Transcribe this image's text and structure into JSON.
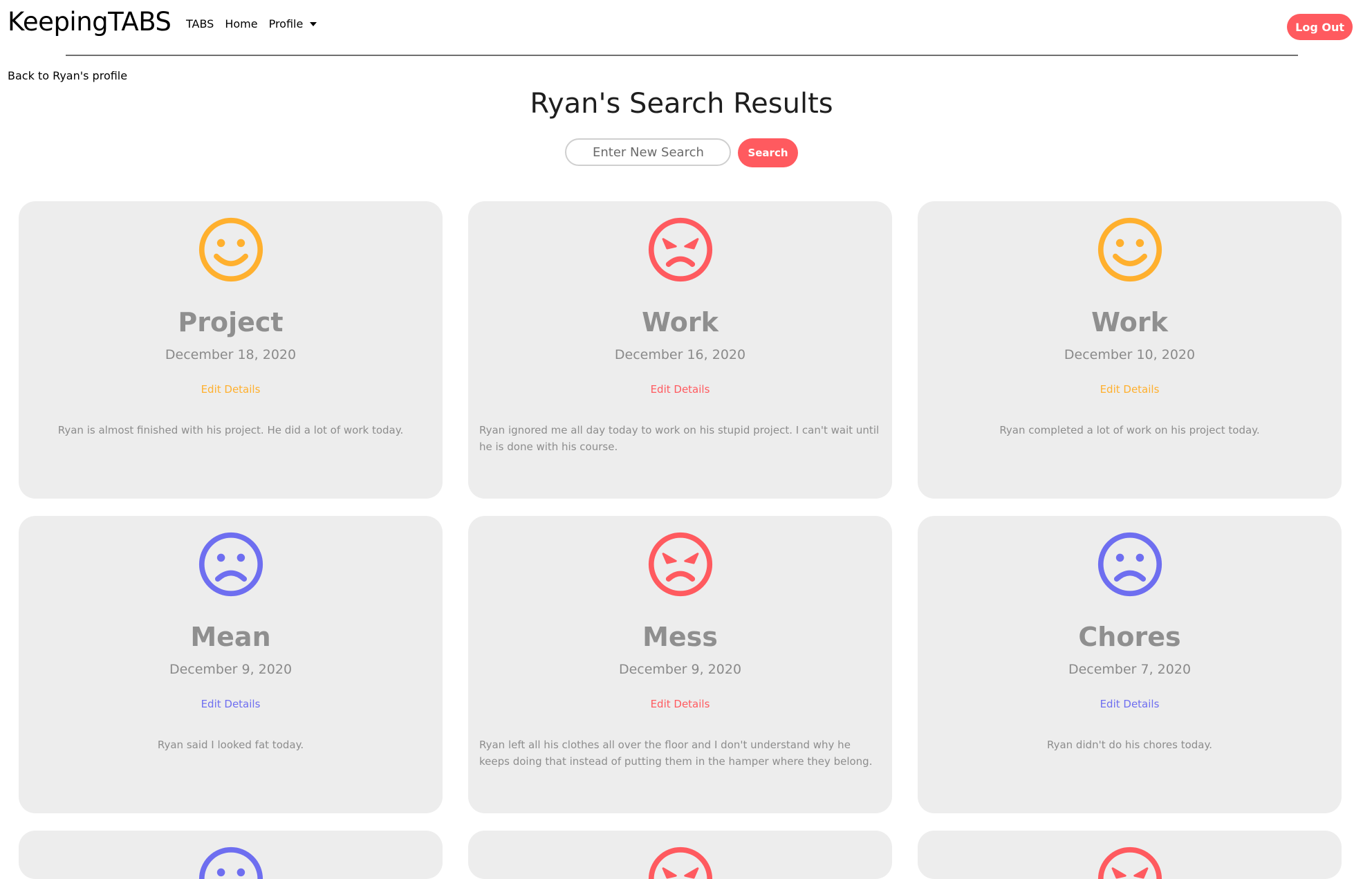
{
  "navbar": {
    "brand": "KeepingTABS",
    "links": [
      "TABS",
      "Home",
      "Profile"
    ],
    "logout_label": "Log Out"
  },
  "back_link": "Back to Ryan's profile",
  "page_title": "Ryan's Search Results",
  "search": {
    "placeholder": "Enter New Search",
    "button_label": "Search"
  },
  "colors": {
    "brand": "#ff5a5f",
    "happy": "#ffb02e",
    "angry": "#ff5a5f",
    "sad": "#6e6ef0"
  },
  "cards": [
    {
      "mood": "happy",
      "icon": "smiley-face-icon",
      "title": "Project",
      "date": "December 18, 2020",
      "edit_label": "Edit Details",
      "body": "Ryan is almost finished with his project. He did a lot of work today."
    },
    {
      "mood": "angry",
      "icon": "angry-face-icon",
      "title": "Work",
      "date": "December 16, 2020",
      "edit_label": "Edit Details",
      "body": "Ryan ignored me all day today to work on his stupid project. I can't wait until he is done with his course."
    },
    {
      "mood": "happy",
      "icon": "smiley-face-icon",
      "title": "Work",
      "date": "December 10, 2020",
      "edit_label": "Edit Details",
      "body": "Ryan completed a lot of work on his project today."
    },
    {
      "mood": "sad",
      "icon": "sad-face-icon",
      "title": "Mean",
      "date": "December 9, 2020",
      "edit_label": "Edit Details",
      "body": "Ryan said I looked fat today."
    },
    {
      "mood": "angry",
      "icon": "angry-face-icon",
      "title": "Mess",
      "date": "December 9, 2020",
      "edit_label": "Edit Details",
      "body": "Ryan left all his clothes all over the floor and I don't understand why he keeps doing that instead of putting them in the hamper where they belong."
    },
    {
      "mood": "sad",
      "icon": "sad-face-icon",
      "title": "Chores",
      "date": "December 7, 2020",
      "edit_label": "Edit Details",
      "body": "Ryan didn't do his chores today."
    },
    {
      "mood": "sad",
      "icon": "sad-face-icon"
    },
    {
      "mood": "angry",
      "icon": "angry-face-icon"
    },
    {
      "mood": "angry",
      "icon": "angry-face-icon"
    }
  ]
}
